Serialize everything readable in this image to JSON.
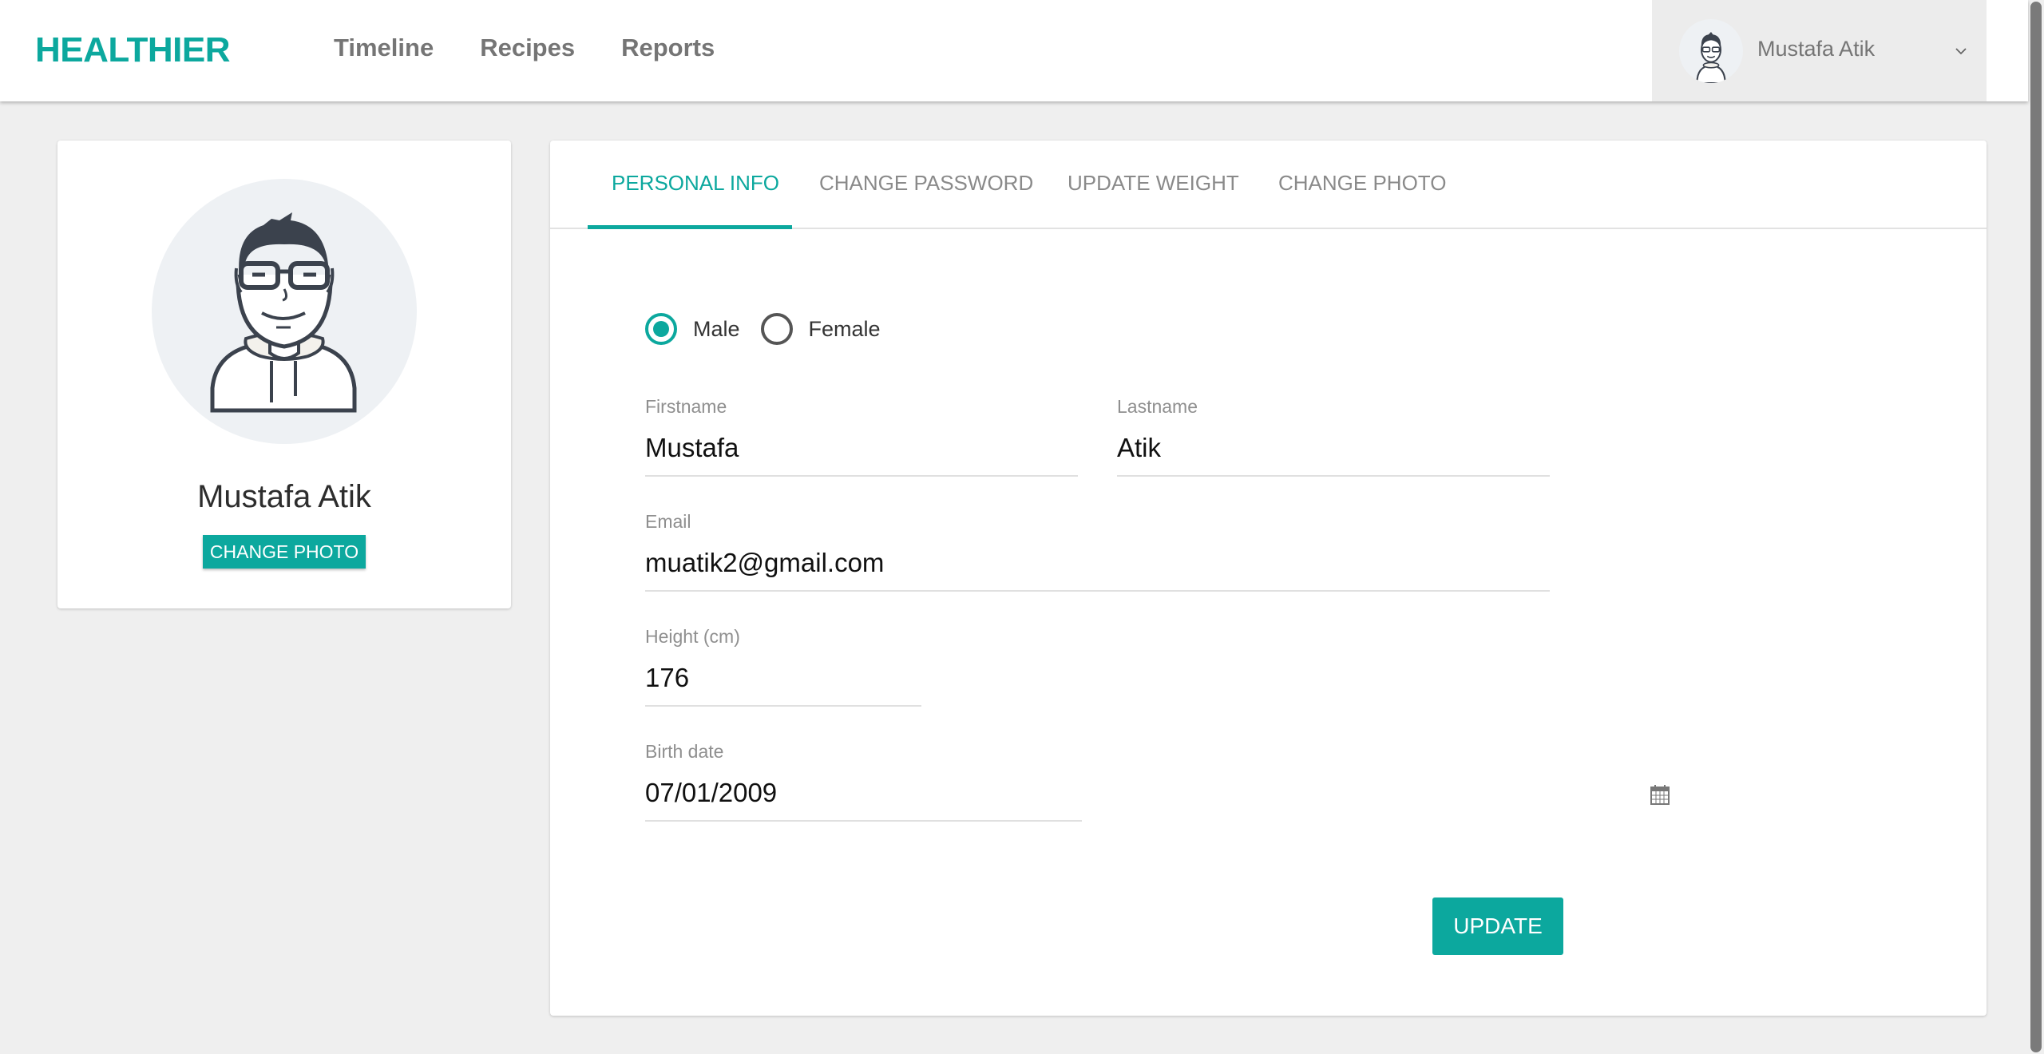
{
  "header": {
    "brand": "HEALTHIER",
    "nav": [
      {
        "label": "Timeline"
      },
      {
        "label": "Recipes"
      },
      {
        "label": "Reports"
      }
    ],
    "user": {
      "name": "Mustafa Atik",
      "avatar_icon": "user-avatar-icon",
      "menu_icon": "chevron-down-icon"
    }
  },
  "profile": {
    "name": "Mustafa Atik",
    "change_photo_label": "CHANGE PHOTO"
  },
  "tabs": [
    {
      "label": "PERSONAL INFO",
      "active": true
    },
    {
      "label": "CHANGE PASSWORD",
      "active": false
    },
    {
      "label": "UPDATE WEIGHT",
      "active": false
    },
    {
      "label": "CHANGE PHOTO",
      "active": false
    }
  ],
  "form": {
    "gender": {
      "options": [
        {
          "label": "Male",
          "checked": true
        },
        {
          "label": "Female",
          "checked": false
        }
      ]
    },
    "firstname": {
      "label": "Firstname",
      "value": "Mustafa"
    },
    "lastname": {
      "label": "Lastname",
      "value": "Atik"
    },
    "email": {
      "label": "Email",
      "value": "muatik2@gmail.com"
    },
    "height": {
      "label": "Height (cm)",
      "value": "176"
    },
    "birthdate": {
      "label": "Birth date",
      "value": "07/01/2009"
    },
    "update_label": "UPDATE"
  },
  "colors": {
    "accent": "#0ca89e",
    "background": "#efefef",
    "nav_text": "#757575"
  }
}
